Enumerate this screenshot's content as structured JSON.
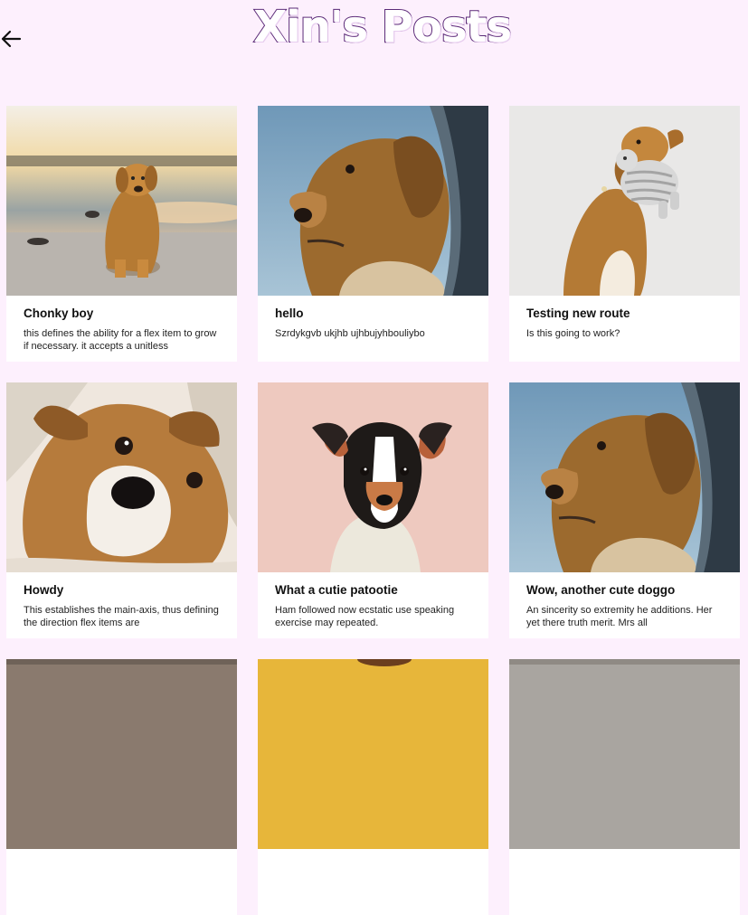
{
  "header": {
    "title": "Xin's Posts",
    "back_icon": "arrow-left-icon"
  },
  "posts": [
    {
      "title": "Chonky boy",
      "description": "this defines the ability for a flex item to grow if necessary. it accepts a unitless",
      "image": "golden-retriever-on-beach"
    },
    {
      "title": "hello",
      "description": "Szrdykgvb ukjhb ujhbujyhbouliybo",
      "image": "spaniel-in-car-window"
    },
    {
      "title": "Testing new route",
      "description": "Is this going to work?",
      "image": "retriever-with-toy"
    },
    {
      "title": "Howdy",
      "description": "This establishes the main-axis, thus defining the direction flex items are",
      "image": "dog-face-closeup"
    },
    {
      "title": "What a cutie patootie",
      "description": "Ham followed now ecstatic use speaking exercise may repeated.",
      "image": "terrier-pink-background"
    },
    {
      "title": "Wow, another cute doggo",
      "description": "An sincerity so extremity he additions. Her yet there truth merit. Mrs all",
      "image": "spaniel-in-car-window"
    }
  ],
  "colors": {
    "page_background": "#fdf0fd",
    "title_outline": "#5b2a78",
    "card_background": "#ffffff"
  }
}
